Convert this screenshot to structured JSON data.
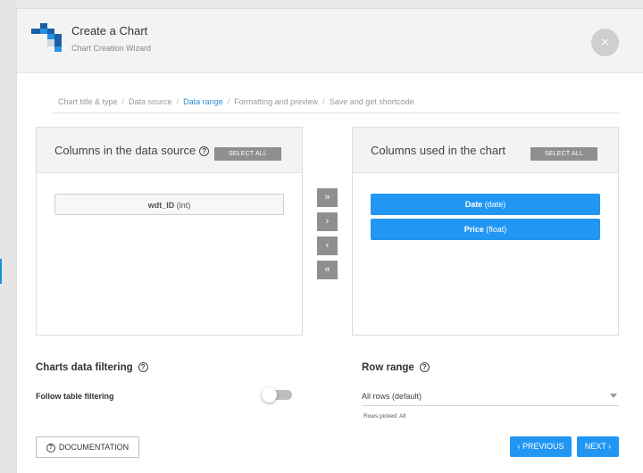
{
  "header": {
    "title": "Create a Chart",
    "subtitle": "Chart Creation Wizard",
    "close_glyph": "×"
  },
  "breadcrumb": {
    "steps": [
      "Chart title & type",
      "Data source",
      "Data range",
      "Formatting and preview",
      "Save and get shortcode"
    ],
    "active_index": 2
  },
  "source_panel": {
    "title": "Columns in the data source",
    "select_all": "SELECT ALL",
    "columns": [
      {
        "name": "wdt_ID",
        "type": "(int)"
      }
    ]
  },
  "used_panel": {
    "title": "Columns used in the chart",
    "select_all": "SELECT ALL",
    "columns": [
      {
        "name": "Date",
        "type": "(date)"
      },
      {
        "name": "Price",
        "type": "(float)"
      }
    ]
  },
  "transfer_buttons": [
    "»",
    "›",
    "‹",
    "«"
  ],
  "filtering": {
    "title": "Charts data filtering",
    "follow_label": "Follow table filtering",
    "follow_enabled": false
  },
  "row_range": {
    "title": "Row range",
    "selected": "All rows (default)",
    "picked_text": "Rows picked: All"
  },
  "footer": {
    "documentation": "DOCUMENTATION",
    "previous": "‹ PREVIOUS",
    "next": "NEXT ›"
  },
  "colors": {
    "accent": "#2196f3",
    "neutral_button": "#8f8f8f",
    "active_breadcrumb": "#2f8fd8"
  },
  "icons": {
    "logo": "wpdatatables-logo-icon",
    "close": "close-icon",
    "help": "help-circle-icon",
    "dropdown": "caret-down-icon"
  }
}
